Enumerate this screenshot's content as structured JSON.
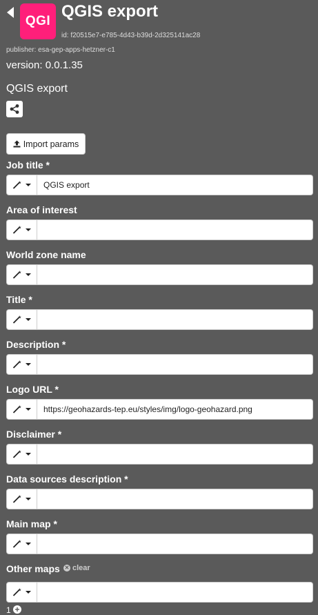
{
  "header": {
    "logo_text": "QGI",
    "title": "QGIS export",
    "id": "id: f20515e7-e785-4d43-b39d-2d325141ac28",
    "publisher": "publisher: esa-gep-apps-hetzner-c1",
    "version": "version: 0.0.1.35",
    "description": "QGIS export"
  },
  "import_button": "Import params",
  "fields": [
    {
      "label": "Job title *",
      "value": "QGIS export"
    },
    {
      "label": "Area of interest",
      "value": ""
    },
    {
      "label": "World zone name",
      "value": ""
    },
    {
      "label": "Title *",
      "value": ""
    },
    {
      "label": "Description *",
      "value": ""
    },
    {
      "label": "Logo URL *",
      "value": "https://geohazards-tep.eu/styles/img/logo-geohazard.png"
    },
    {
      "label": "Disclaimer *",
      "value": ""
    },
    {
      "label": "Data sources description *",
      "value": ""
    },
    {
      "label": "Main map *",
      "value": ""
    },
    {
      "label": "Other maps",
      "value": ""
    }
  ],
  "clear_label": "clear",
  "other_maps_count": "1",
  "colors": {
    "background": "#5a5a5a",
    "logo": "#ff1f7a"
  },
  "icons": [
    "back-icon",
    "share-icon",
    "upload-icon",
    "wand-icon",
    "caret-down-icon",
    "clear-icon",
    "add-icon"
  ]
}
